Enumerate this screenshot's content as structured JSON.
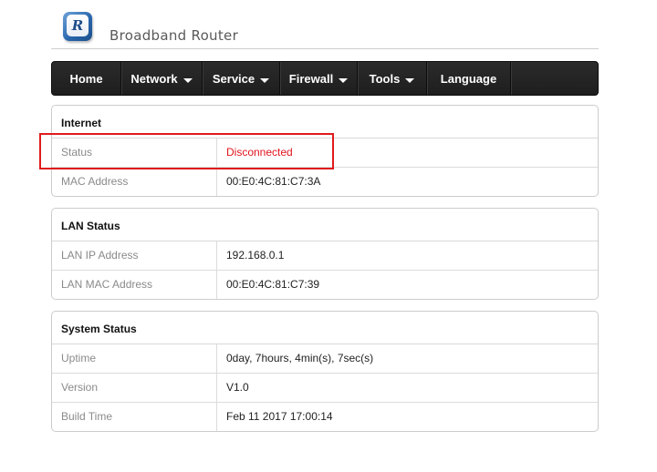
{
  "header": {
    "logo_letter": "R",
    "title": "Broadband Router"
  },
  "nav": [
    {
      "label": "Home",
      "dropdown": false
    },
    {
      "label": "Network",
      "dropdown": true
    },
    {
      "label": "Service",
      "dropdown": true
    },
    {
      "label": "Firewall",
      "dropdown": true
    },
    {
      "label": "Tools",
      "dropdown": true
    },
    {
      "label": "Language",
      "dropdown": false
    }
  ],
  "panels": {
    "internet": {
      "title": "Internet",
      "rows": [
        {
          "label": "Status",
          "value": "Disconnected"
        },
        {
          "label": "MAC Address",
          "value": "00:E0:4C:81:C7:3A"
        }
      ]
    },
    "lan": {
      "title": "LAN Status",
      "rows": [
        {
          "label": "LAN IP Address",
          "value": "192.168.0.1"
        },
        {
          "label": "LAN MAC Address",
          "value": "00:E0:4C:81:C7:39"
        }
      ]
    },
    "system": {
      "title": "System Status",
      "rows": [
        {
          "label": "Uptime",
          "value": "0day, 7hours, 4min(s), 7sec(s)"
        },
        {
          "label": "Version",
          "value": "V1.0"
        },
        {
          "label": "Build Time",
          "value": "Feb 11 2017 17:00:14"
        }
      ]
    }
  },
  "colors": {
    "status_disconnected": "#e0141e",
    "highlight_box": "#e01b1b",
    "navbar_bg": "#222222"
  }
}
